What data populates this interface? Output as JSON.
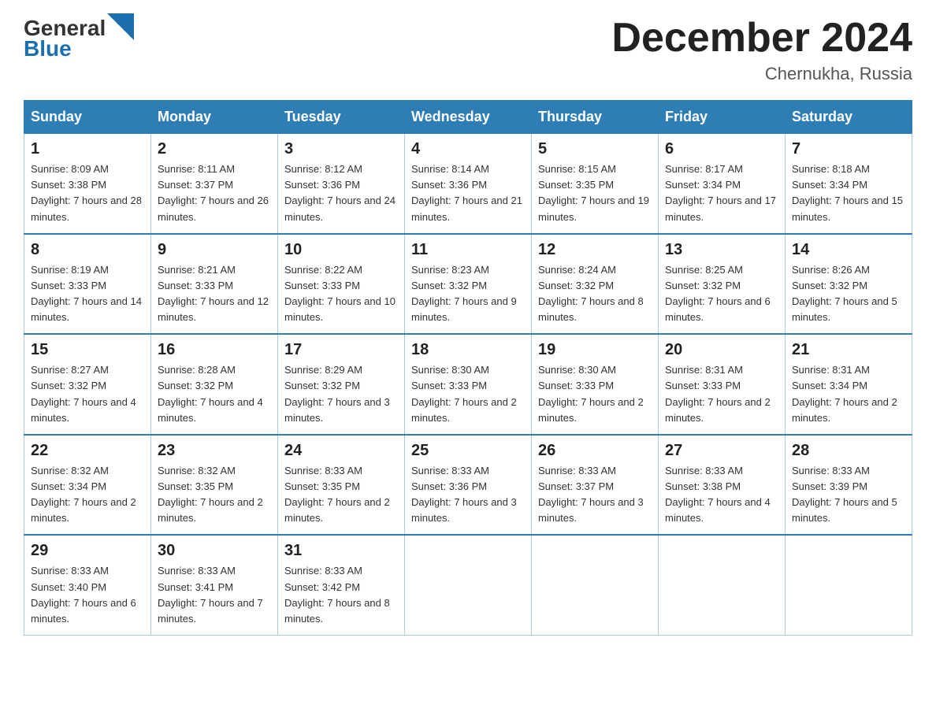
{
  "header": {
    "logo_text_black": "General",
    "logo_text_blue": "Blue",
    "month_title": "December 2024",
    "location": "Chernukha, Russia"
  },
  "weekdays": [
    "Sunday",
    "Monday",
    "Tuesday",
    "Wednesday",
    "Thursday",
    "Friday",
    "Saturday"
  ],
  "weeks": [
    [
      {
        "day": "1",
        "sunrise": "8:09 AM",
        "sunset": "3:38 PM",
        "daylight": "7 hours and 28 minutes."
      },
      {
        "day": "2",
        "sunrise": "8:11 AM",
        "sunset": "3:37 PM",
        "daylight": "7 hours and 26 minutes."
      },
      {
        "day": "3",
        "sunrise": "8:12 AM",
        "sunset": "3:36 PM",
        "daylight": "7 hours and 24 minutes."
      },
      {
        "day": "4",
        "sunrise": "8:14 AM",
        "sunset": "3:36 PM",
        "daylight": "7 hours and 21 minutes."
      },
      {
        "day": "5",
        "sunrise": "8:15 AM",
        "sunset": "3:35 PM",
        "daylight": "7 hours and 19 minutes."
      },
      {
        "day": "6",
        "sunrise": "8:17 AM",
        "sunset": "3:34 PM",
        "daylight": "7 hours and 17 minutes."
      },
      {
        "day": "7",
        "sunrise": "8:18 AM",
        "sunset": "3:34 PM",
        "daylight": "7 hours and 15 minutes."
      }
    ],
    [
      {
        "day": "8",
        "sunrise": "8:19 AM",
        "sunset": "3:33 PM",
        "daylight": "7 hours and 14 minutes."
      },
      {
        "day": "9",
        "sunrise": "8:21 AM",
        "sunset": "3:33 PM",
        "daylight": "7 hours and 12 minutes."
      },
      {
        "day": "10",
        "sunrise": "8:22 AM",
        "sunset": "3:33 PM",
        "daylight": "7 hours and 10 minutes."
      },
      {
        "day": "11",
        "sunrise": "8:23 AM",
        "sunset": "3:32 PM",
        "daylight": "7 hours and 9 minutes."
      },
      {
        "day": "12",
        "sunrise": "8:24 AM",
        "sunset": "3:32 PM",
        "daylight": "7 hours and 8 minutes."
      },
      {
        "day": "13",
        "sunrise": "8:25 AM",
        "sunset": "3:32 PM",
        "daylight": "7 hours and 6 minutes."
      },
      {
        "day": "14",
        "sunrise": "8:26 AM",
        "sunset": "3:32 PM",
        "daylight": "7 hours and 5 minutes."
      }
    ],
    [
      {
        "day": "15",
        "sunrise": "8:27 AM",
        "sunset": "3:32 PM",
        "daylight": "7 hours and 4 minutes."
      },
      {
        "day": "16",
        "sunrise": "8:28 AM",
        "sunset": "3:32 PM",
        "daylight": "7 hours and 4 minutes."
      },
      {
        "day": "17",
        "sunrise": "8:29 AM",
        "sunset": "3:32 PM",
        "daylight": "7 hours and 3 minutes."
      },
      {
        "day": "18",
        "sunrise": "8:30 AM",
        "sunset": "3:33 PM",
        "daylight": "7 hours and 2 minutes."
      },
      {
        "day": "19",
        "sunrise": "8:30 AM",
        "sunset": "3:33 PM",
        "daylight": "7 hours and 2 minutes."
      },
      {
        "day": "20",
        "sunrise": "8:31 AM",
        "sunset": "3:33 PM",
        "daylight": "7 hours and 2 minutes."
      },
      {
        "day": "21",
        "sunrise": "8:31 AM",
        "sunset": "3:34 PM",
        "daylight": "7 hours and 2 minutes."
      }
    ],
    [
      {
        "day": "22",
        "sunrise": "8:32 AM",
        "sunset": "3:34 PM",
        "daylight": "7 hours and 2 minutes."
      },
      {
        "day": "23",
        "sunrise": "8:32 AM",
        "sunset": "3:35 PM",
        "daylight": "7 hours and 2 minutes."
      },
      {
        "day": "24",
        "sunrise": "8:33 AM",
        "sunset": "3:35 PM",
        "daylight": "7 hours and 2 minutes."
      },
      {
        "day": "25",
        "sunrise": "8:33 AM",
        "sunset": "3:36 PM",
        "daylight": "7 hours and 3 minutes."
      },
      {
        "day": "26",
        "sunrise": "8:33 AM",
        "sunset": "3:37 PM",
        "daylight": "7 hours and 3 minutes."
      },
      {
        "day": "27",
        "sunrise": "8:33 AM",
        "sunset": "3:38 PM",
        "daylight": "7 hours and 4 minutes."
      },
      {
        "day": "28",
        "sunrise": "8:33 AM",
        "sunset": "3:39 PM",
        "daylight": "7 hours and 5 minutes."
      }
    ],
    [
      {
        "day": "29",
        "sunrise": "8:33 AM",
        "sunset": "3:40 PM",
        "daylight": "7 hours and 6 minutes."
      },
      {
        "day": "30",
        "sunrise": "8:33 AM",
        "sunset": "3:41 PM",
        "daylight": "7 hours and 7 minutes."
      },
      {
        "day": "31",
        "sunrise": "8:33 AM",
        "sunset": "3:42 PM",
        "daylight": "7 hours and 8 minutes."
      },
      null,
      null,
      null,
      null
    ]
  ]
}
